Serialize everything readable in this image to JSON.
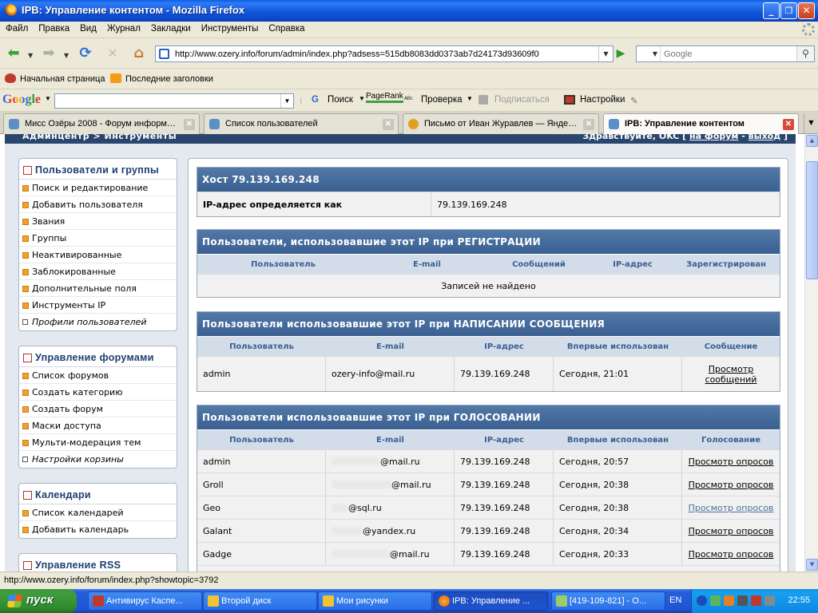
{
  "window": {
    "title": "IPB: Управление контентом - Mozilla Firefox",
    "buttons": {
      "minimize": "_",
      "maximize": "❐",
      "close": "✕"
    }
  },
  "menu": [
    "Файл",
    "Правка",
    "Вид",
    "Журнал",
    "Закладки",
    "Инструменты",
    "Справка"
  ],
  "nav": {
    "url": "http://www.ozery.info/forum/admin/index.php?adsess=515db8083dd0373ab7d24173d93609f0",
    "search_placeholder": "Google"
  },
  "bookmarks": [
    "Начальная страница",
    "Последние заголовки"
  ],
  "google_toolbar": {
    "logo": "Google",
    "items": [
      "Поиск",
      "PageRank",
      "Проверка",
      "Подписаться",
      "Настройки"
    ]
  },
  "tabs": [
    {
      "label": "Мисс Озёры 2008 - Форум информац...",
      "active": false
    },
    {
      "label": "Список пользователей",
      "active": false
    },
    {
      "label": "Письмо от Иван Журавлев — Яндек...",
      "active": false
    },
    {
      "label": "IPB: Управление контентом",
      "active": true
    }
  ],
  "acp": {
    "breadcrumb": "Админцентр > Инструменты",
    "greeting": "Здравствуйте, OKC [",
    "to_forum": "на форум",
    "sep": "-",
    "logout": "выход",
    "close_bracket": "]"
  },
  "sidebar": [
    {
      "title": "Пользователи и группы",
      "items": [
        "Поиск и редактирование",
        "Добавить пользователя",
        "Звания",
        "Группы",
        "Неактивированные",
        "Заблокированные",
        "Дополнительные поля",
        "Инструменты IP",
        "Профили пользователей"
      ],
      "italic_last": true
    },
    {
      "title": "Управление форумами",
      "items": [
        "Список форумов",
        "Создать категорию",
        "Создать форум",
        "Маски доступа",
        "Мульти-модерация тем",
        "Настройки корзины"
      ],
      "italic_last": true
    },
    {
      "title": "Календари",
      "items": [
        "Список календарей",
        "Добавить календарь"
      ],
      "italic_last": false
    },
    {
      "title": "Управление RSS",
      "items": [],
      "italic_last": false
    }
  ],
  "host": {
    "title": "Хост 79.139.169.248",
    "label": "IP-адрес определяется как",
    "value": "79.139.169.248"
  },
  "registration": {
    "title": "Пользователи, использовавшие этот IP при РЕГИСТРАЦИИ",
    "columns": [
      "Пользователь",
      "E-mail",
      "Сообщений",
      "IP-адрес",
      "Зарегистрирован"
    ],
    "empty": "Записей не найдено"
  },
  "posting": {
    "title": "Пользователи использовавшие этот IP при НАПИСАНИИ СООБЩЕНИЯ",
    "columns": [
      "Пользователь",
      "E-mail",
      "IP-адрес",
      "Впервые использован",
      "Сообщение"
    ],
    "rows": [
      {
        "user": "admin",
        "email": "ozery-info@mail.ru",
        "ip": "79.139.169.248",
        "first": "Сегодня, 21:01",
        "action": "Просмотр сообщений"
      }
    ]
  },
  "voting": {
    "title": "Пользователи использовавшие этот IP при ГОЛОСОВАНИИ",
    "columns": [
      "Пользователь",
      "E-mail",
      "IP-адрес",
      "Впервые использован",
      "Голосование"
    ],
    "rows": [
      {
        "user": "admin",
        "email": "@mail.ru",
        "ip": "79.139.169.248",
        "first": "Сегодня, 20:57",
        "action": "Просмотр опросов",
        "visited": false
      },
      {
        "user": "Groll",
        "email": "@mail.ru",
        "ip": "79.139.169.248",
        "first": "Сегодня, 20:38",
        "action": "Просмотр опросов",
        "visited": false
      },
      {
        "user": "Geo",
        "email": "@sql.ru",
        "ip": "79.139.169.248",
        "first": "Сегодня, 20:38",
        "action": "Просмотр опросов",
        "visited": true
      },
      {
        "user": "Galant",
        "email": "@yandex.ru",
        "ip": "79.139.169.248",
        "first": "Сегодня, 20:34",
        "action": "Просмотр опросов",
        "visited": false
      },
      {
        "user": "Gadge",
        "email": "@mail.ru",
        "ip": "79.139.169.248",
        "first": "Сегодня, 20:33",
        "action": "Просмотр опросов",
        "visited": false
      }
    ]
  },
  "status": "http://www.ozery.info/forum/index.php?showtopic=3792",
  "taskbar": {
    "start": "пуск",
    "tasks": [
      "Антивирус Каспе...",
      "Второй диск",
      "Мои рисунки",
      "IPB: Управление ...",
      "[419-109-821] - О..."
    ],
    "lang": "EN",
    "clock": "22:55"
  },
  "colors": {
    "acp_header": "#2b466e",
    "table_header": "#4a6fa0",
    "column_header_bg": "#d3dde9",
    "sidebar_title": "#1c3e6e"
  }
}
